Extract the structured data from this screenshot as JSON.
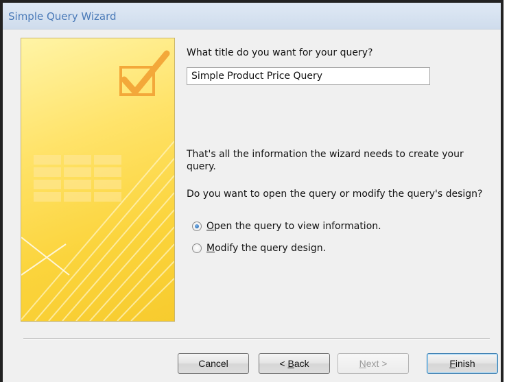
{
  "window": {
    "title": "Simple Query Wizard"
  },
  "prompt": {
    "question": "What title do you want for your query?"
  },
  "title_field": {
    "value": "Simple Product Price Query"
  },
  "info": {
    "line1": "That's all the information the wizard needs to create your query.",
    "line2": "Do you want to open the query or modify the query's design?"
  },
  "options": [
    {
      "mnemonic": "O",
      "rest": "pen the query to view information.",
      "checked": true
    },
    {
      "mnemonic": "M",
      "rest": "odify the query design.",
      "checked": false
    }
  ],
  "buttons": {
    "cancel": "Cancel",
    "back_prefix": "< ",
    "back_mnemonic": "B",
    "back_rest": "ack",
    "next_prefix": "",
    "next_mnemonic": "N",
    "next_rest": "ext >",
    "finish_mnemonic": "F",
    "finish_rest": "inish"
  },
  "icons": {
    "banner_graphic": "wizard-banner-checkmark-icon"
  }
}
